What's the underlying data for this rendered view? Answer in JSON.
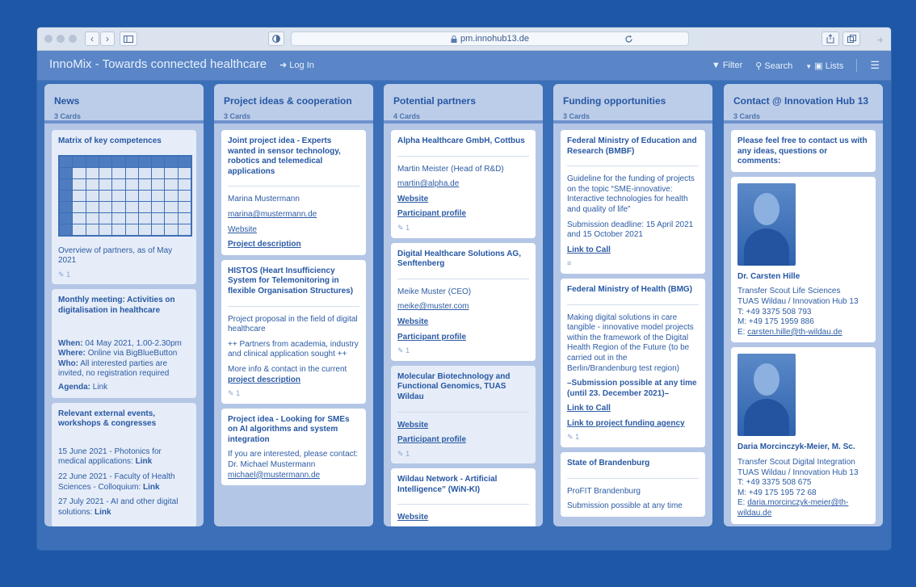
{
  "browser": {
    "url": "pm.innohub13.de",
    "back_glyph": "‹",
    "forward_glyph": "›"
  },
  "app": {
    "title": "InnoMix - Towards connected healthcare",
    "login": "Log In",
    "filter": "Filter",
    "search": "Search",
    "lists": "Lists"
  },
  "lists": [
    {
      "title": "News",
      "count": "3 Cards",
      "cards": [
        {
          "title": "Matrix of key competences",
          "text": "Overview of partners, as of May 2021",
          "attachments": "1"
        },
        {
          "title": "Monthly meeting: Activities on digitalisation in healthcare",
          "when_label": "When:",
          "when": "04 May 2021, 1.00-2.30pm",
          "where_label": "Where:",
          "where": "Online via BigBlueButton",
          "who_label": "Who:",
          "who": "All interested parties are invited, no registration required",
          "agenda_label": "Agenda:",
          "agenda": "Link"
        },
        {
          "title": "Relevant external events, workshops & congresses",
          "e1": "15 June 2021 - Photonics for medical applications:",
          "e1_link": "Link",
          "e2": "22 June 2021 - Faculty of Health Sciences - Colloquium:",
          "e2_link": "Link",
          "e3": "27 July 2021 - AI and other digital solutions:",
          "e3_link": "Link"
        }
      ]
    },
    {
      "title": "Project ideas & cooperation",
      "count": "3 Cards",
      "cards": [
        {
          "title": "Joint project idea - Experts wanted in sensor technology, robotics and telemedical applications",
          "name": "Marina Mustermann",
          "email": "marina@mustermann.de",
          "website": "Website",
          "desc": "Project description"
        },
        {
          "title": "HISTOS (Heart Insufficiency System for Telemonitoring in flexible Organisation Structures)",
          "p1": "Project proposal in the field of digital healthcare",
          "p2": "++ Partners from academia, industry and clinical application sought ++",
          "p3": "More info & contact in the current",
          "p3_link": "project description",
          "attachments": "1"
        },
        {
          "title": "Project idea - Looking for SMEs on AI algorithms and system integration",
          "p1": "If you are interested, please contact:",
          "p2": "Dr. Michael Mustermann",
          "email": "michael@mustermann.de"
        }
      ]
    },
    {
      "title": "Potential partners",
      "count": "4 Cards",
      "cards": [
        {
          "title": "Alpha Healthcare GmbH, Cottbus",
          "name": "Martin Meister (Head of R&D)",
          "email": "martin@alpha.de",
          "website": "Website",
          "profile": "Participant profile",
          "attachments": "1"
        },
        {
          "title": "Digital Healthcare Solutions AG, Senftenberg",
          "name": "Meike Muster (CEO)",
          "email": "meike@muster.com",
          "website": "Website",
          "profile": "Participant profile",
          "attachments": "1"
        },
        {
          "title": "Molecular Biotechnology and Functional Genomics, TUAS Wildau",
          "website": "Website",
          "profile": "Participant profile",
          "attachments": "1"
        },
        {
          "title": "Wildau Network - Artificial Intelligence” (WiN-KI)",
          "website": "Website"
        }
      ]
    },
    {
      "title": "Funding opportunities",
      "count": "3 Cards",
      "cards": [
        {
          "title": "Federal Ministry of Education and Research (BMBF)",
          "p1": "Guideline for the funding of projects on the topic “SME-innovative: Interactive technologies for health and quality of life”",
          "p2": "Submission deadline: 15 April 2021 and 15 October 2021",
          "link": "Link to Call"
        },
        {
          "title": "Federal Ministry of Health (BMG)",
          "p1": "Making digital solutions in care tangible - innovative model projects within the framework of the Digital Health Region of the Future (to be carried out in the Berlin/Brandenburg test region)",
          "p2": "–Submission possible at any time (until 23. December 2021)–",
          "link": "Link to Call",
          "link2": "Link to project funding agency",
          "attachments": "1"
        },
        {
          "title": "State of Brandenburg",
          "p1": "ProFIT Brandenburg",
          "p2": "Submission possible at any time"
        }
      ]
    },
    {
      "title": "Contact @ Innovation Hub 13",
      "count": "3 Cards",
      "cards": [
        {
          "title": "Please feel free to contact us with any ideas, questions or comments:"
        },
        {
          "name": "Dr. Carsten Hille",
          "role": "Transfer Scout Life Sciences",
          "org": "TUAS Wildau / Innovation Hub 13",
          "tel": "T: +49 3375 508 793",
          "mob": "M: +49 175 1959 886",
          "email_label": "E:",
          "email": "carsten.hille@th-wildau.de"
        },
        {
          "name": "Daria Morcinczyk-Meier, M. Sc.",
          "role": "Transfer Scout Digital Integration",
          "org": "TUAS Wildau / Innovation Hub 13",
          "tel": "T: +49 3375 508 675",
          "mob": "M: +49 175 195 72 68",
          "email_label": "E:",
          "email": "daria.morcinczyk-meier@th-wildau.de"
        }
      ]
    }
  ]
}
